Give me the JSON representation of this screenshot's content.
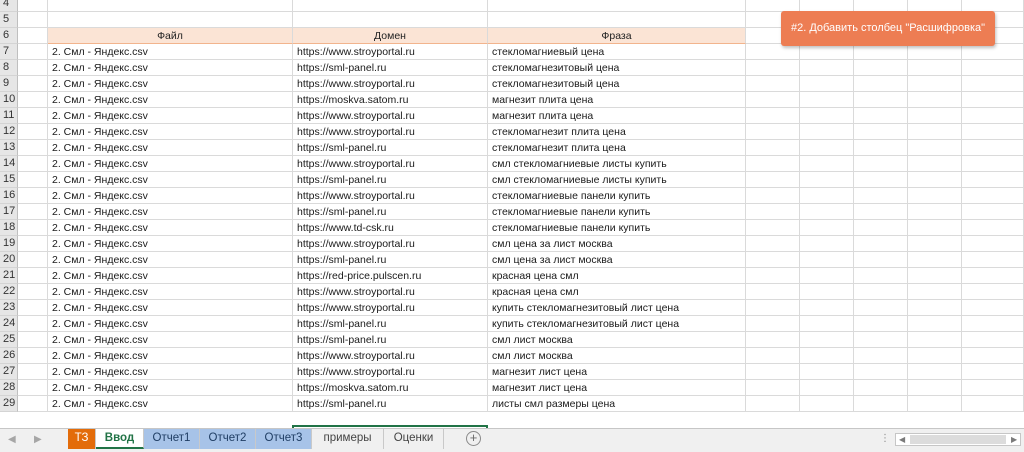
{
  "note": {
    "text": "#2. Добавить столбец \"Расшифровка\""
  },
  "header": {
    "row_num": "6",
    "file": "Файл",
    "domain": "Домен",
    "phrase": "Фраза"
  },
  "top_rows": [
    "4",
    "5"
  ],
  "rows": [
    {
      "n": "7",
      "file": "2. Смл - Яндекс.csv",
      "domain": "https://www.stroyportal.ru",
      "phrase": "стекломагниевый цена"
    },
    {
      "n": "8",
      "file": "2. Смл - Яндекс.csv",
      "domain": "https://sml-panel.ru",
      "phrase": "стекломагнезитовый цена"
    },
    {
      "n": "9",
      "file": "2. Смл - Яндекс.csv",
      "domain": "https://www.stroyportal.ru",
      "phrase": "стекломагнезитовый цена"
    },
    {
      "n": "10",
      "file": "2. Смл - Яндекс.csv",
      "domain": "https://moskva.satom.ru",
      "phrase": "магнезит плита цена"
    },
    {
      "n": "11",
      "file": "2. Смл - Яндекс.csv",
      "domain": "https://www.stroyportal.ru",
      "phrase": "магнезит плита цена"
    },
    {
      "n": "12",
      "file": "2. Смл - Яндекс.csv",
      "domain": "https://www.stroyportal.ru",
      "phrase": "стекломагнезит плита цена"
    },
    {
      "n": "13",
      "file": "2. Смл - Яндекс.csv",
      "domain": "https://sml-panel.ru",
      "phrase": "стекломагнезит плита цена"
    },
    {
      "n": "14",
      "file": "2. Смл - Яндекс.csv",
      "domain": "https://www.stroyportal.ru",
      "phrase": "смл стекломагниевые листы купить"
    },
    {
      "n": "15",
      "file": "2. Смл - Яндекс.csv",
      "domain": "https://sml-panel.ru",
      "phrase": "смл стекломагниевые листы купить"
    },
    {
      "n": "16",
      "file": "2. Смл - Яндекс.csv",
      "domain": "https://www.stroyportal.ru",
      "phrase": "стекломагниевые панели купить"
    },
    {
      "n": "17",
      "file": "2. Смл - Яндекс.csv",
      "domain": "https://sml-panel.ru",
      "phrase": "стекломагниевые панели купить"
    },
    {
      "n": "18",
      "file": "2. Смл - Яндекс.csv",
      "domain": "https://www.td-csk.ru",
      "phrase": "стекломагниевые панели купить"
    },
    {
      "n": "19",
      "file": "2. Смл - Яндекс.csv",
      "domain": "https://www.stroyportal.ru",
      "phrase": "смл цена за лист москва"
    },
    {
      "n": "20",
      "file": "2. Смл - Яндекс.csv",
      "domain": "https://sml-panel.ru",
      "phrase": "смл цена за лист москва"
    },
    {
      "n": "21",
      "file": "2. Смл - Яндекс.csv",
      "domain": "https://red-price.pulscen.ru",
      "phrase": "красная цена смл"
    },
    {
      "n": "22",
      "file": "2. Смл - Яндекс.csv",
      "domain": "https://www.stroyportal.ru",
      "phrase": "красная цена смл"
    },
    {
      "n": "23",
      "file": "2. Смл - Яндекс.csv",
      "domain": "https://www.stroyportal.ru",
      "phrase": "купить стекломагнезитовый лист цена"
    },
    {
      "n": "24",
      "file": "2. Смл - Яндекс.csv",
      "domain": "https://sml-panel.ru",
      "phrase": "купить стекломагнезитовый лист цена"
    },
    {
      "n": "25",
      "file": "2. Смл - Яндекс.csv",
      "domain": "https://sml-panel.ru",
      "phrase": "смл лист москва"
    },
    {
      "n": "26",
      "file": "2. Смл - Яндекс.csv",
      "domain": "https://www.stroyportal.ru",
      "phrase": "смл лист москва"
    },
    {
      "n": "27",
      "file": "2. Смл - Яндекс.csv",
      "domain": "https://www.stroyportal.ru",
      "phrase": "магнезит лист цена"
    },
    {
      "n": "28",
      "file": "2. Смл - Яндекс.csv",
      "domain": "https://moskva.satom.ru",
      "phrase": "магнезит лист цена"
    },
    {
      "n": "29",
      "file": "2. Смл - Яндекс.csv",
      "domain": "https://sml-panel.ru",
      "phrase": "листы смл размеры цена"
    }
  ],
  "tabs": [
    {
      "label": "ТЗ",
      "style": "orange"
    },
    {
      "label": "Ввод",
      "style": "active"
    },
    {
      "label": "Отчет1",
      "style": "blue"
    },
    {
      "label": "Отчет2",
      "style": "blue"
    },
    {
      "label": "Отчет3",
      "style": "blue"
    },
    {
      "label": "примеры",
      "style": "plain"
    },
    {
      "label": "Оценки",
      "style": "plain"
    }
  ],
  "add_sheet_symbol": "+",
  "colors": {
    "accent_green": "#217346",
    "note_orange": "#ed7d53",
    "header_peach": "#fbe4d5",
    "tab_orange": "#e36c0a",
    "tab_blue": "#a7c3e8"
  }
}
